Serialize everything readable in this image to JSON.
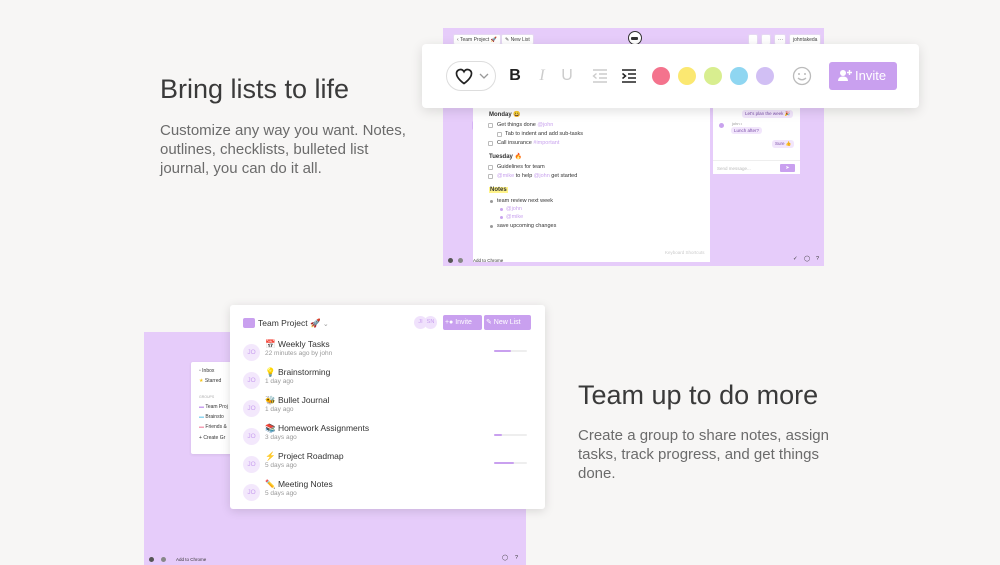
{
  "section1": {
    "title": "Bring lists to life",
    "description": "Customize any way you want. Notes, outlines, checklists, bulleted list journal, you can do it all."
  },
  "shot1": {
    "breadcrumb": "Team Project 🚀",
    "new_list": "New List",
    "user": "johntakeda",
    "page": {
      "monday": "Monday 😀",
      "item1": "Get things done",
      "item1_tag": "@john",
      "item2": "Tab to indent and add sub-tasks",
      "item3": "Call insurance",
      "item3_tag": "#important",
      "tuesday": "Tuesday 🔥",
      "item4": "Guidelines for team",
      "item5_tag": "@mike",
      "item5": "to help",
      "item5_tag2": "@john",
      "item5_end": "get started",
      "notes": "Notes",
      "bullet1": "team review next week",
      "sub1": "@john",
      "sub2": "@mike",
      "bullet2": "save upcoming changes",
      "footer": "Keyboard Shortcuts"
    },
    "chat": {
      "msg1": "Let's plan the week 🎉",
      "sender": "john •",
      "msg2": "Lunch after?",
      "msg3": "Sure 👍",
      "placeholder": "Send message...",
      "send": "➤"
    },
    "bottom": {
      "add": "Add to Chrome"
    }
  },
  "toolbar": {
    "heart_icon": "heart-icon",
    "bold": "B",
    "italic": "I",
    "underline": "U",
    "invite": "Invite",
    "colors": [
      "#f4738d",
      "#fbe871",
      "#d8ee8f",
      "#8fd6f1",
      "#d1bff4"
    ]
  },
  "section2": {
    "title": "Team up to do more",
    "description": "Create a group to share notes, assign tasks, track progress, and get things done."
  },
  "shot2": {
    "sidebar": {
      "inbox": "Inbox",
      "starred": "Starred",
      "groups": "GROUPS",
      "g1": "Team Proj",
      "g2": "Brainsto",
      "g3": "Friends &",
      "create": "Create Gr"
    },
    "bottom": {
      "add": "Add to Chrome"
    },
    "card": {
      "title": "Team Project 🚀",
      "avatar1": "JI",
      "avatar2": "SN",
      "invite": "Invite",
      "new_list": "New List",
      "rows": [
        {
          "avatar": "JO",
          "name": "📅 Weekly Tasks",
          "sub": "22 minutes ago by john",
          "progress": 0.5
        },
        {
          "avatar": "JO",
          "name": "💡 Brainstorming",
          "sub": "1 day ago",
          "progress": null
        },
        {
          "avatar": "JO",
          "name": "🐝 Bullet Journal",
          "sub": "1 day ago",
          "progress": null
        },
        {
          "avatar": "JO",
          "name": "📚 Homework Assignments",
          "sub": "3 days ago",
          "progress": 0.25
        },
        {
          "avatar": "JO",
          "name": "⚡ Project Roadmap",
          "sub": "5 days ago",
          "progress": 0.6
        },
        {
          "avatar": "JO",
          "name": "✏️ Meeting Notes",
          "sub": "5 days ago",
          "progress": null
        }
      ]
    }
  }
}
